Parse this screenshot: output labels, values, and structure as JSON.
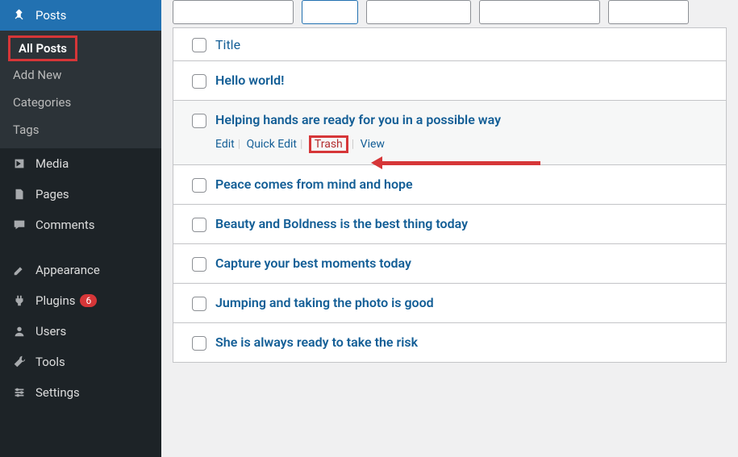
{
  "sidebar": {
    "posts": {
      "label": "Posts",
      "open": true
    },
    "submenu": {
      "all_posts": "All Posts",
      "add_new": "Add New",
      "categories": "Categories",
      "tags": "Tags"
    },
    "media": "Media",
    "pages": "Pages",
    "comments": "Comments",
    "appearance": "Appearance",
    "plugins": "Plugins",
    "plugins_badge": "6",
    "users": "Users",
    "tools": "Tools",
    "settings": "Settings"
  },
  "table": {
    "col_title": "Title",
    "row_actions": {
      "edit": "Edit",
      "quick_edit": "Quick Edit",
      "trash": "Trash",
      "view": "View"
    },
    "rows": [
      {
        "title": "Hello world!"
      },
      {
        "title": "Helping hands are ready for you in a possible way"
      },
      {
        "title": "Peace comes from mind and hope"
      },
      {
        "title": "Beauty and Boldness is the best thing today"
      },
      {
        "title": "Capture your best moments today"
      },
      {
        "title": "Jumping and taking the photo is good"
      },
      {
        "title": "She is always ready to take the risk"
      }
    ]
  }
}
